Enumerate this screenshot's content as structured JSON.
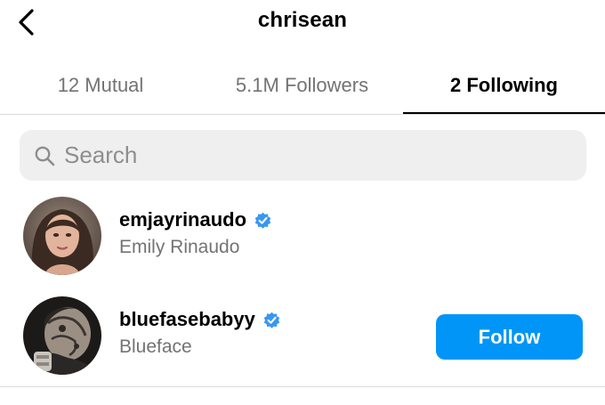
{
  "header": {
    "title": "chrisean"
  },
  "tabs": [
    {
      "label": "12 Mutual",
      "active": false
    },
    {
      "label": "5.1M Followers",
      "active": false
    },
    {
      "label": "2 Following",
      "active": true
    }
  ],
  "search": {
    "placeholder": "Search",
    "value": ""
  },
  "following": [
    {
      "username": "emjayrinaudo",
      "full_name": "Emily Rinaudo",
      "verified": true
    },
    {
      "username": "bluefasebabyy",
      "full_name": "Blueface",
      "verified": true,
      "follow_button_label": "Follow"
    }
  ],
  "colors": {
    "accent": "#0095f6",
    "verified": "#3897f0",
    "secondary_text": "#737373",
    "search_bg": "#efefef"
  },
  "icons": {
    "back": "chevron-left-icon",
    "search": "search-icon",
    "verified": "verified-badge-icon"
  }
}
